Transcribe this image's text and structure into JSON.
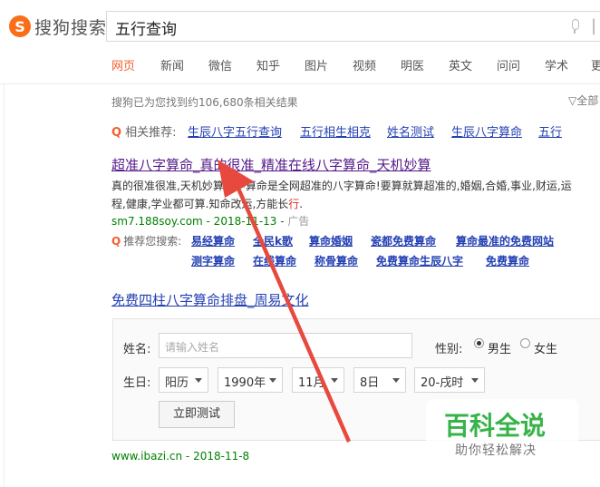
{
  "header": {
    "logo_mark": "S",
    "logo_text": "搜狗搜索",
    "query": "五行查询",
    "nav": [
      "网页",
      "新闻",
      "微信",
      "知乎",
      "图片",
      "视频",
      "明医",
      "英文",
      "问问",
      "学术",
      "更"
    ]
  },
  "stats": {
    "text": "搜狗已为您找到约106,680条相关结果",
    "filter": "全部"
  },
  "related": {
    "label": "相关推荐:",
    "links": [
      "生辰八字五行查询",
      "五行相生相克",
      "姓名测试",
      "生辰八字算命",
      "五行"
    ]
  },
  "result1": {
    "title": "超准八字算命_真的很准_精准在线八字算命_天机妙算",
    "snippet_line1": "真的很准很准,天机妙算八字算命是全网超准的八字算命!要算就算超准的,婚姻,合婚,事业,财运,运",
    "snippet_line2_a": "程,健康,学业都可算.知命改",
    "snippet_line2_b": "运,方能长",
    "snippet_line2_red": "行",
    "snippet_line2_c": ".",
    "cite": "sm7.188soy.com - 2018-11-13 -",
    "ad": "广告",
    "suggest_label": "推荐您搜索:",
    "suggest_row1": [
      "易经算命",
      "全民k歌",
      "算命婚姻",
      "瓷都免费算命",
      "算命最准的免费网站"
    ],
    "suggest_row2": [
      "测字算命",
      "在线算命",
      "称骨算命",
      "免费算命生辰八字",
      "免费算命"
    ]
  },
  "result2": {
    "title": "免费四柱八字算命排盘_周易文化",
    "name_label": "姓名:",
    "name_placeholder": "请输入姓名",
    "gender_label": "性别:",
    "gender_male": "男生",
    "gender_female": "女生",
    "gender_selected": "男生",
    "birth_label": "生日:",
    "calendar": "阳历",
    "year": "1990年",
    "month": "11月",
    "day": "8日",
    "hour": "20-戌时",
    "submit": "立即测试",
    "cite": "www.ibazi.cn - 2018-11-8"
  },
  "watermark": {
    "title": "百科全说",
    "subtitle": "助你轻松解决"
  },
  "colors": {
    "accent": "#f25f2e",
    "link": "#2440b3",
    "visited": "#551a8b",
    "cite": "#008000",
    "arrow": "#e8493f"
  }
}
